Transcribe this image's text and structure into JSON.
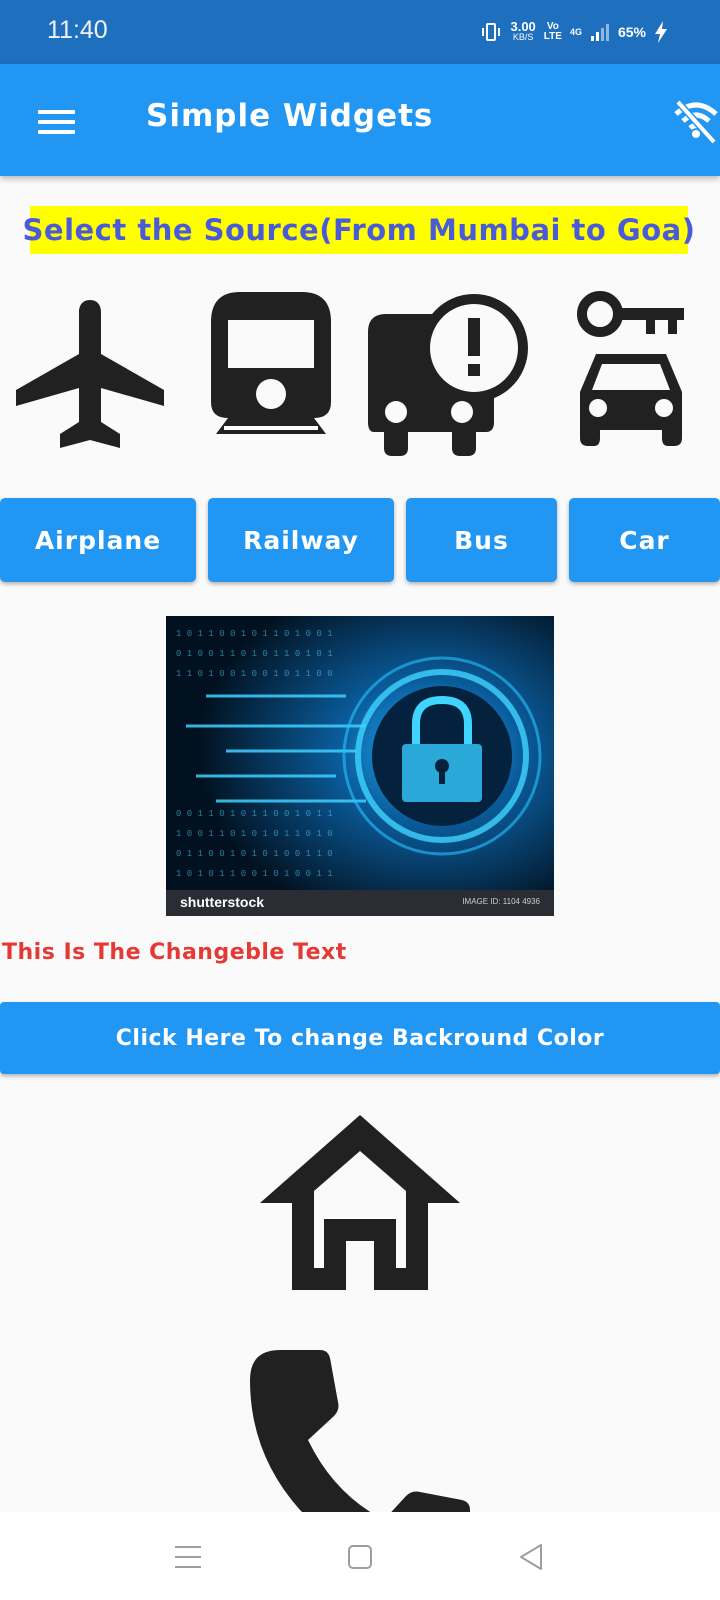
{
  "status_bar": {
    "time": "11:40",
    "net_speed_value": "3.00",
    "net_speed_unit": "KB/S",
    "volte_line1": "Vo",
    "volte_line2": "LTE",
    "network": "4G",
    "battery": "65%",
    "icons": [
      "vibrate-icon",
      "signal-icon",
      "charging-icon"
    ]
  },
  "app_bar": {
    "title": "Simple Widgets",
    "menu_icon": "hamburger-menu-icon",
    "action_icon": "wifi-off-icon"
  },
  "heading": "Select the Source(From Mumbai to Goa)",
  "transport_icons": [
    "airplane-icon",
    "train-icon",
    "bus-alert-icon",
    "car-rental-icon"
  ],
  "buttons": {
    "airplane": "Airplane",
    "railway": "Railway",
    "bus": "Bus",
    "car": "Car"
  },
  "image": {
    "brand": "shutterstock",
    "id_text": "IMAGE ID: 1104 4936",
    "subject": "lock-security-icon"
  },
  "changeable_text": "This Is The Changeble Text",
  "change_bg_button": "Click Here To change Backround Color",
  "bottom_icons": [
    "home-icon",
    "phone-icon"
  ],
  "nav_bar": [
    "menu-nav-icon",
    "home-nav-icon",
    "back-nav-icon"
  ],
  "colors": {
    "status_bar": "#1e6fbe",
    "primary": "#2196f3",
    "heading_bg": "#ffff00",
    "heading_text": "#4a5bd9",
    "changeable_text": "#e53935",
    "icon": "#212121",
    "background": "#fafafa"
  }
}
